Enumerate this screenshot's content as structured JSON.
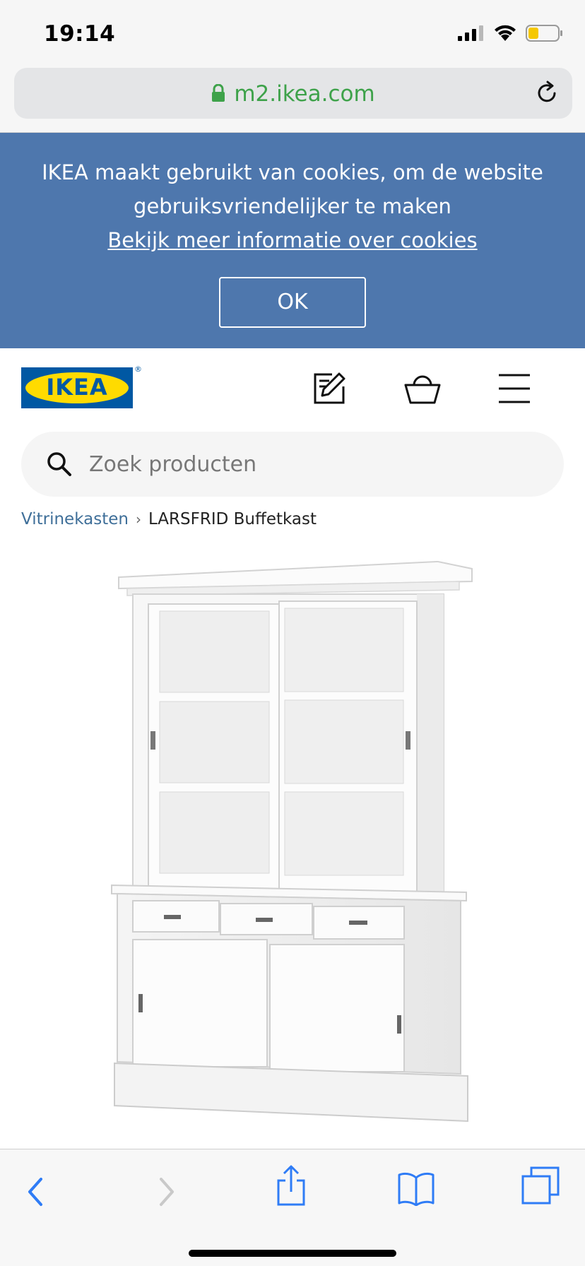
{
  "status_bar": {
    "time": "19:14",
    "icons": [
      "signal-icon",
      "wifi-icon",
      "battery-icon"
    ]
  },
  "browser": {
    "url": "m2.ikea.com",
    "icons": [
      "lock-icon",
      "reload-icon"
    ]
  },
  "cookie_banner": {
    "message": "IKEA maakt gebruikt van cookies, om de website gebruiksvriendelijker te maken",
    "link": "Bekijk meer informatie over cookies",
    "ok_label": "OK",
    "background": "#4e77ad"
  },
  "header": {
    "logo_text": "IKEA",
    "logo_registered": "®",
    "icons": [
      "shopping-list-icon",
      "basket-icon",
      "menu-icon"
    ],
    "brand_blue": "#0058a3",
    "brand_yellow": "#ffdb00"
  },
  "search": {
    "placeholder": "Zoek producten",
    "value": ""
  },
  "breadcrumb": {
    "parent": "Vitrinekasten",
    "current": "LARSFRID Buffetkast"
  },
  "toolbar": {
    "icons": [
      "back-icon",
      "forward-icon",
      "share-icon",
      "bookmarks-icon",
      "tabs-icon"
    ],
    "accent": "#2f7cf6"
  }
}
